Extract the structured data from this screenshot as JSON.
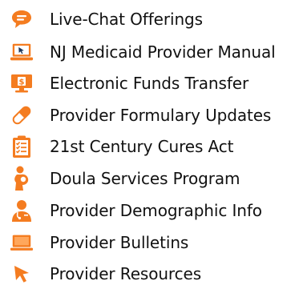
{
  "colors": {
    "accent": "#f47c20",
    "text": "#111111",
    "background": "#ffffff"
  },
  "links": [
    {
      "label": "Live-Chat Offerings",
      "icon": "chat-bubble-icon"
    },
    {
      "label": "NJ Medicaid Provider Manual",
      "icon": "laptop-cursor-icon"
    },
    {
      "label": "Electronic Funds Transfer",
      "icon": "monitor-dollar-icon"
    },
    {
      "label": "Provider Formulary Updates",
      "icon": "pill-capsule-icon"
    },
    {
      "label": "21st Century Cures Act",
      "icon": "clipboard-checklist-icon"
    },
    {
      "label": "Doula Services Program",
      "icon": "mother-baby-icon"
    },
    {
      "label": "Provider Demographic Info",
      "icon": "doctor-person-icon"
    },
    {
      "label": "Provider Bulletins",
      "icon": "laptop-icon"
    },
    {
      "label": "Provider Resources",
      "icon": "cursor-arrow-icon"
    }
  ]
}
